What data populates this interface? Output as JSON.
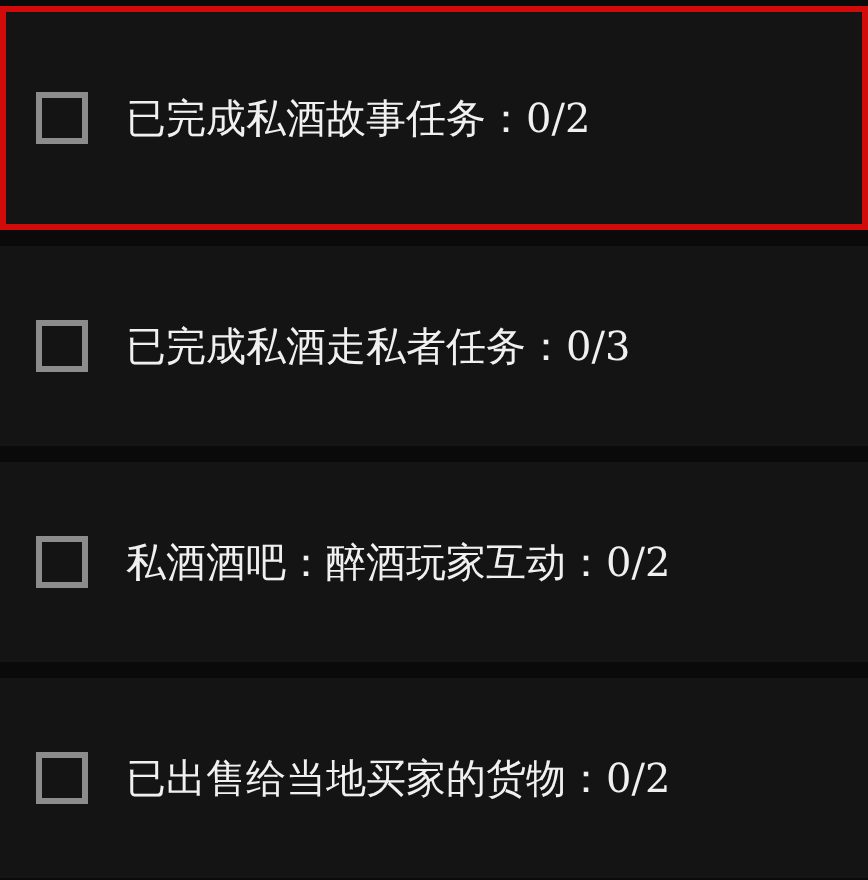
{
  "objectives": [
    {
      "label": "已完成私酒故事任务：0/2",
      "checked": false,
      "selected": true
    },
    {
      "label": "已完成私酒走私者任务：0/3",
      "checked": false,
      "selected": false
    },
    {
      "label": "私酒酒吧：醉酒玩家互动：0/2",
      "checked": false,
      "selected": false
    },
    {
      "label": "已出售给当地买家的货物：0/2",
      "checked": false,
      "selected": false
    }
  ]
}
